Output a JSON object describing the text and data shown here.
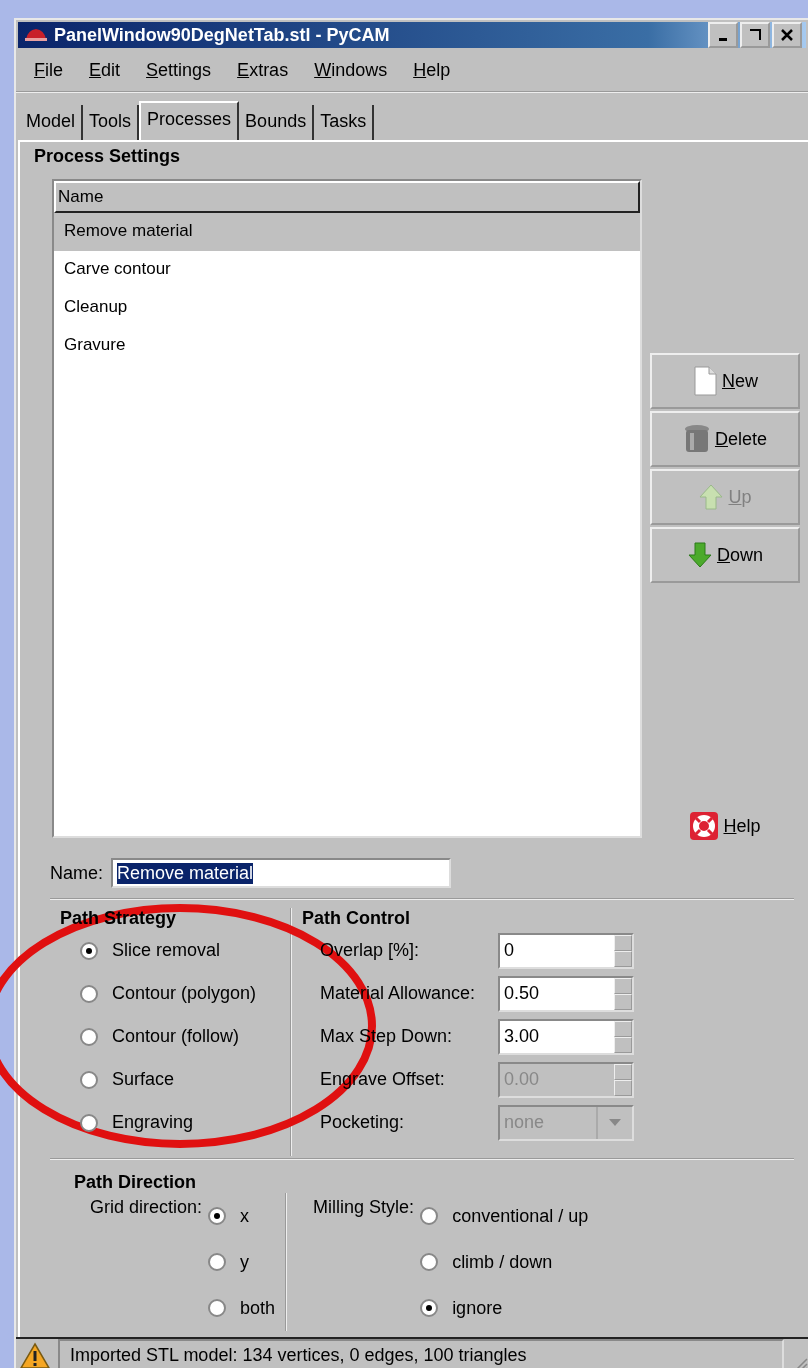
{
  "window": {
    "title": "PanelWindow90DegNetTab.stl - PyCAM"
  },
  "menu": [
    "File",
    "Edit",
    "Settings",
    "Extras",
    "Windows",
    "Help"
  ],
  "tabs": [
    {
      "label": "Model",
      "selected": false
    },
    {
      "label": "Tools",
      "selected": false
    },
    {
      "label": "Processes",
      "selected": true
    },
    {
      "label": "Bounds",
      "selected": false
    },
    {
      "label": "Tasks",
      "selected": false
    }
  ],
  "section_title": "Process Settings",
  "process_list": {
    "column": "Name",
    "rows": [
      {
        "label": "Remove material",
        "selected": true
      },
      {
        "label": "Carve contour",
        "selected": false
      },
      {
        "label": "Cleanup",
        "selected": false
      },
      {
        "label": "Gravure",
        "selected": false
      }
    ]
  },
  "buttons": [
    {
      "kind": "new",
      "label": "New",
      "disabled": false
    },
    {
      "kind": "delete",
      "label": "Delete",
      "disabled": false
    },
    {
      "kind": "up",
      "label": "Up",
      "disabled": true
    },
    {
      "kind": "down",
      "label": "Down",
      "disabled": false
    }
  ],
  "help_button": {
    "label": "Help"
  },
  "name_field": {
    "label": "Name:",
    "value": "Remove material"
  },
  "path_strategy": {
    "title": "Path Strategy",
    "options": [
      {
        "label": "Slice removal",
        "selected": true
      },
      {
        "label": "Contour (polygon)",
        "selected": false
      },
      {
        "label": "Contour (follow)",
        "selected": false
      },
      {
        "label": "Surface",
        "selected": false
      },
      {
        "label": "Engraving",
        "selected": false
      }
    ]
  },
  "path_control": {
    "title": "Path Control",
    "fields": [
      {
        "kind": "spin",
        "label": "Overlap [%]:",
        "value": "0",
        "disabled": false
      },
      {
        "kind": "spin",
        "label": "Material Allowance:",
        "value": "0.50",
        "disabled": false
      },
      {
        "kind": "spin",
        "label": "Max Step Down:",
        "value": "3.00",
        "disabled": false
      },
      {
        "kind": "spin",
        "label": "Engrave Offset:",
        "value": "0.00",
        "disabled": true
      },
      {
        "kind": "dropdown",
        "label": "Pocketing:",
        "value": "none",
        "disabled": true
      }
    ]
  },
  "path_direction": {
    "title": "Path Direction",
    "grid_direction": {
      "label": "Grid direction:",
      "options": [
        {
          "label": "x",
          "selected": true
        },
        {
          "label": "y",
          "selected": false
        },
        {
          "label": "both",
          "selected": false
        }
      ]
    },
    "milling_style": {
      "label": "Milling Style:",
      "options": [
        {
          "label": "conventional / up",
          "selected": false
        },
        {
          "label": "climb / down",
          "selected": false
        },
        {
          "label": "ignore",
          "selected": true
        }
      ]
    }
  },
  "status_bar": {
    "text": "Imported STL model: 134 vertices, 0 edges, 100 triangles"
  }
}
